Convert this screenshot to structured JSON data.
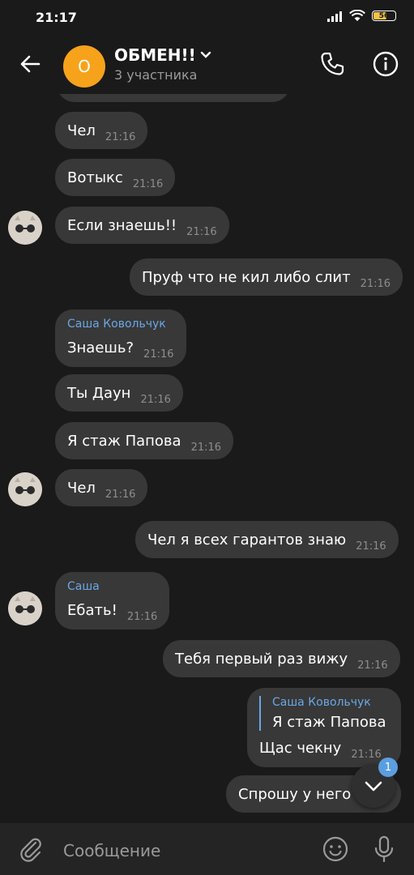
{
  "status_bar": {
    "time": "21:17",
    "battery_level": "56"
  },
  "header": {
    "avatar_letter": "О",
    "title": "ОБМЕН!!",
    "subtitle": "3 участника"
  },
  "messages": [
    {
      "text": "Чел",
      "time": "21:16"
    },
    {
      "text": "Вотыкс",
      "time": "21:16"
    },
    {
      "text": "Если знаешь!!",
      "time": "21:16"
    },
    {
      "text": "Пруф что не кил либо слит",
      "time": "21:16"
    },
    {
      "sender": "Саша Ковольчук",
      "text": "Знаешь?",
      "time": "21:16"
    },
    {
      "text": "Ты Даун",
      "time": "21:16"
    },
    {
      "text": "Я стаж Папова",
      "time": "21:16"
    },
    {
      "text": "Чел",
      "time": "21:16"
    },
    {
      "text": "Чел я всех гарантов знаю",
      "time": "21:16"
    },
    {
      "sender": "Саша",
      "text": "Ебать!",
      "time": "21:16"
    },
    {
      "text": "Тебя первый раз вижу",
      "time": "21:16"
    },
    {
      "reply_to_name": "Саша Ковольчук",
      "reply_to_text": "Я стаж Папова",
      "text": "Щас чекну",
      "time": "21:16"
    },
    {
      "text": "Спрошу у него",
      "time": ""
    }
  ],
  "scroll_button": {
    "unread_count": "1"
  },
  "composer": {
    "placeholder": "Сообщение"
  },
  "colors": {
    "background": "#1a1a1a",
    "bubble": "#383838",
    "accent": "#6aa7e6",
    "avatar": "#f7a21b"
  }
}
